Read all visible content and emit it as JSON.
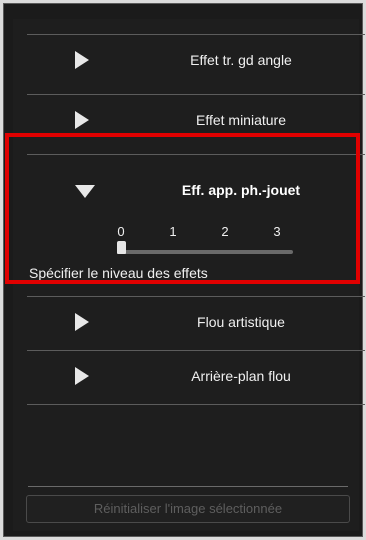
{
  "effects": {
    "items": [
      {
        "label": "Effet tr. gd angle"
      },
      {
        "label": "Effet miniature"
      }
    ],
    "expanded": {
      "label": "Eff. app. ph.-jouet",
      "slider": {
        "ticks": [
          "0",
          "1",
          "2",
          "3"
        ],
        "value": 0
      },
      "description": "Spécifier le niveau des effets"
    },
    "more_items": [
      {
        "label": "Flou artistique"
      },
      {
        "label": "Arrière-plan flou"
      }
    ]
  },
  "footer": {
    "reset_label": "Réinitialiser l'image sélectionnée"
  },
  "colors": {
    "panel_bg": "#1e1e1e",
    "highlight": "#e00000",
    "text": "#f0f0f0",
    "disabled_text": "#5e5e5e"
  }
}
